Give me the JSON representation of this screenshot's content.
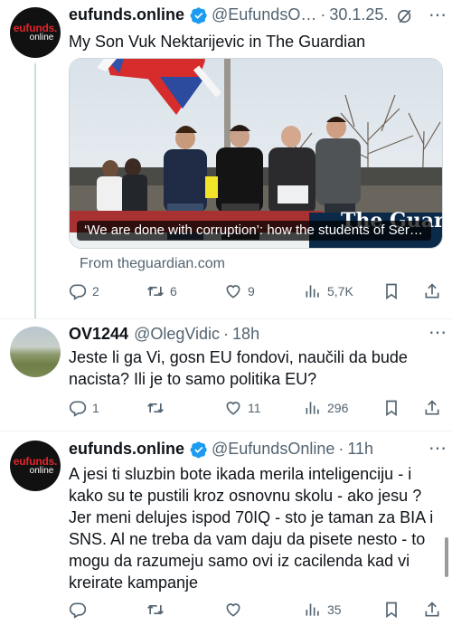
{
  "tweets": [
    {
      "avatar_text_1": "eufunds.",
      "avatar_text_2": "online",
      "name": "eufunds.online",
      "handle": "@EufundsO…",
      "sep": "·",
      "time": "30.1.25.",
      "text": "My Son Vuk Nektarijevic in The Guardian",
      "card": {
        "caption": "‘We are done with corruption’: how the students of Serb…",
        "source": "From theguardian.com",
        "overlay_logo": "The Guardian"
      },
      "stats": {
        "replies": "2",
        "retweets": "6",
        "likes": "9",
        "views": "5,7K"
      }
    },
    {
      "name": "OV1244",
      "handle": "@OlegVidic",
      "sep": "·",
      "time": "18h",
      "text": "Jeste li ga Vi, gosn EU fondovi, naučili da bude nacista? Ili je to samo politika EU?",
      "stats": {
        "replies": "1",
        "retweets": "",
        "likes": "11",
        "views": "296"
      }
    },
    {
      "avatar_text_1": "eufunds.",
      "avatar_text_2": "online",
      "name": "eufunds.online",
      "handle": "@EufundsOnline",
      "sep": "·",
      "time": "11h",
      "text": "A jesi ti sluzbin bote ikada merila inteligenciju - i kako su te pustili kroz osnovnu skolu - ako jesu ? Jer meni delujes ispod 70IQ - sto je taman za BIA i SNS. Al ne treba da vam daju da pisete nesto - to mogu da razumeju samo ovi iz cacilenda kad vi kreirate kampanje",
      "stats": {
        "replies": "",
        "retweets": "",
        "likes": "",
        "views": "35"
      }
    }
  ],
  "colors": {
    "verified": "#1d9bf0",
    "muted": "#536471",
    "divider": "#eff3f4"
  }
}
